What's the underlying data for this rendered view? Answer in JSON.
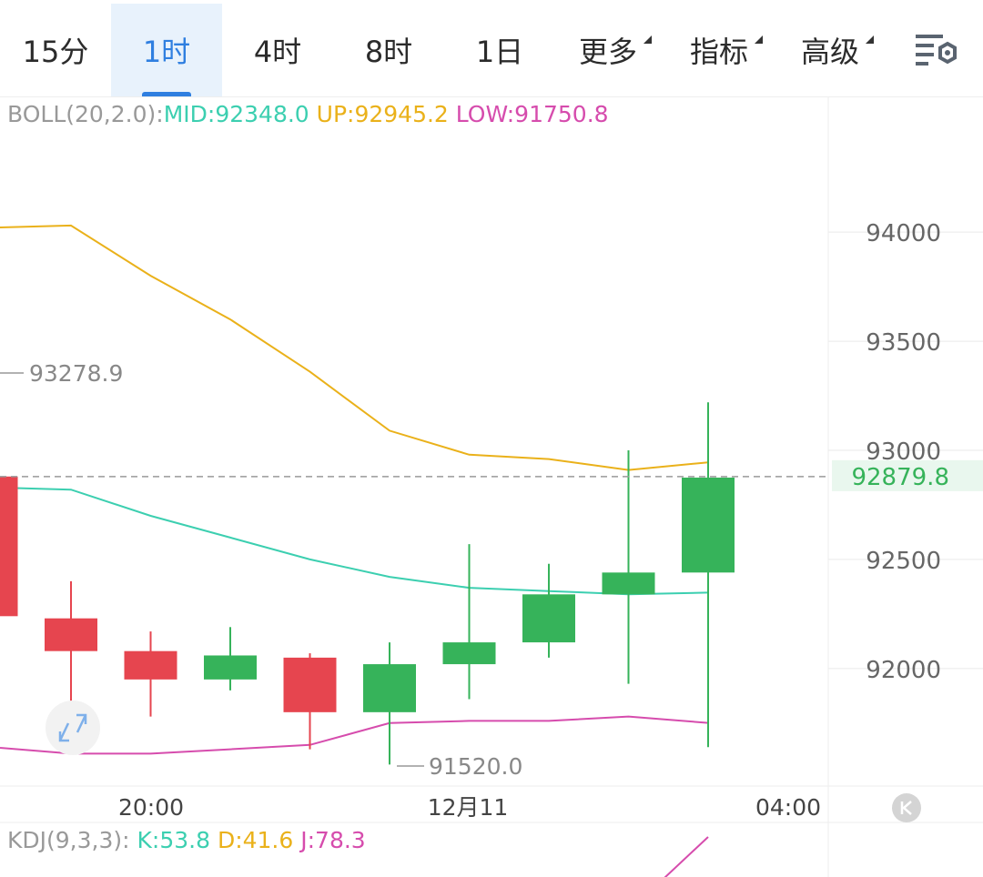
{
  "tabs": [
    {
      "label": "15分",
      "active": false,
      "dropdown": false
    },
    {
      "label": "1时",
      "active": true,
      "dropdown": false
    },
    {
      "label": "4时",
      "active": false,
      "dropdown": false
    },
    {
      "label": "8时",
      "active": false,
      "dropdown": false
    },
    {
      "label": "1日",
      "active": false,
      "dropdown": false
    },
    {
      "label": "更多",
      "active": false,
      "dropdown": true
    },
    {
      "label": "指标",
      "active": false,
      "dropdown": true
    },
    {
      "label": "高级",
      "active": false,
      "dropdown": true
    }
  ],
  "settings_icon": "chart-settings-icon",
  "colors": {
    "up": "#36b35a",
    "down": "#e6454f",
    "mid": "#3ccfb0",
    "upper": "#eab11a",
    "lower": "#d64cad",
    "accent": "#2f7fe0"
  },
  "boll": {
    "label": "BOLL(20,2.0):",
    "mid": "MID:92348.0",
    "up": "UP:92945.2",
    "low": "LOW:91750.8"
  },
  "kdj": {
    "label": "KDJ(9,3,3):",
    "k": "K:53.8",
    "d": "D:41.6",
    "j": "J:78.3"
  },
  "high_label": "93278.9",
  "low_label": "91520.0",
  "current_price": "92879.8",
  "scroll_icon": "scroll-to-latest-icon",
  "expand_icon": "expand-arrows-icon",
  "chart_data": {
    "type": "candlestick",
    "interval": "1时",
    "y_ticks": [
      94000,
      93500,
      93000,
      92500,
      92000
    ],
    "ylim": [
      91470,
      94530
    ],
    "x_tick_labels": [
      "20:00",
      "12月11",
      "04:00"
    ],
    "current_price": 92879.8,
    "candles": [
      {
        "open": 92880,
        "close": 92240,
        "high": 92880,
        "low": 92240
      },
      {
        "open": 92230,
        "close": 92080,
        "high": 92400,
        "low": 91720
      },
      {
        "open": 92080,
        "close": 91950,
        "high": 92170,
        "low": 91780
      },
      {
        "open": 91950,
        "close": 92060,
        "high": 92190,
        "low": 91900
      },
      {
        "open": 92050,
        "close": 91800,
        "high": 92070,
        "low": 91630
      },
      {
        "open": 91800,
        "close": 92020,
        "high": 92120,
        "low": 91560
      },
      {
        "open": 92020,
        "close": 92120,
        "high": 92570,
        "low": 91860
      },
      {
        "open": 92120,
        "close": 92340,
        "high": 92480,
        "low": 92050
      },
      {
        "open": 92340,
        "close": 92440,
        "high": 93000,
        "low": 91930
      },
      {
        "open": 92440,
        "close": 92875,
        "high": 93220,
        "low": 91640
      }
    ],
    "boll_up": [
      94020,
      94030,
      93800,
      93600,
      93360,
      93090,
      92980,
      92960,
      92910,
      92945
    ],
    "boll_mid": [
      92830,
      92820,
      92700,
      92600,
      92500,
      92420,
      92370,
      92355,
      92340,
      92348
    ],
    "boll_low": [
      91640,
      91610,
      91610,
      91630,
      91650,
      91750,
      91760,
      91760,
      91780,
      91751
    ],
    "kdj_j": [
      60,
      78.3
    ]
  }
}
